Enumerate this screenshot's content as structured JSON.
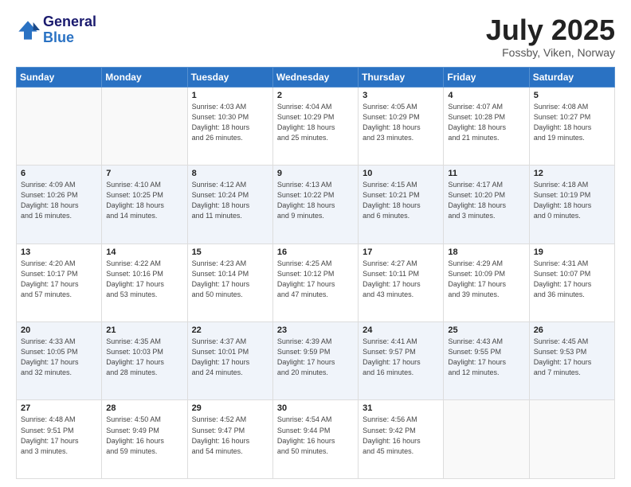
{
  "header": {
    "logo_line1": "General",
    "logo_line2": "Blue",
    "month": "July 2025",
    "location": "Fossby, Viken, Norway"
  },
  "days_of_week": [
    "Sunday",
    "Monday",
    "Tuesday",
    "Wednesday",
    "Thursday",
    "Friday",
    "Saturday"
  ],
  "weeks": [
    [
      {
        "day": "",
        "info": ""
      },
      {
        "day": "",
        "info": ""
      },
      {
        "day": "1",
        "info": "Sunrise: 4:03 AM\nSunset: 10:30 PM\nDaylight: 18 hours\nand 26 minutes."
      },
      {
        "day": "2",
        "info": "Sunrise: 4:04 AM\nSunset: 10:29 PM\nDaylight: 18 hours\nand 25 minutes."
      },
      {
        "day": "3",
        "info": "Sunrise: 4:05 AM\nSunset: 10:29 PM\nDaylight: 18 hours\nand 23 minutes."
      },
      {
        "day": "4",
        "info": "Sunrise: 4:07 AM\nSunset: 10:28 PM\nDaylight: 18 hours\nand 21 minutes."
      },
      {
        "day": "5",
        "info": "Sunrise: 4:08 AM\nSunset: 10:27 PM\nDaylight: 18 hours\nand 19 minutes."
      }
    ],
    [
      {
        "day": "6",
        "info": "Sunrise: 4:09 AM\nSunset: 10:26 PM\nDaylight: 18 hours\nand 16 minutes."
      },
      {
        "day": "7",
        "info": "Sunrise: 4:10 AM\nSunset: 10:25 PM\nDaylight: 18 hours\nand 14 minutes."
      },
      {
        "day": "8",
        "info": "Sunrise: 4:12 AM\nSunset: 10:24 PM\nDaylight: 18 hours\nand 11 minutes."
      },
      {
        "day": "9",
        "info": "Sunrise: 4:13 AM\nSunset: 10:22 PM\nDaylight: 18 hours\nand 9 minutes."
      },
      {
        "day": "10",
        "info": "Sunrise: 4:15 AM\nSunset: 10:21 PM\nDaylight: 18 hours\nand 6 minutes."
      },
      {
        "day": "11",
        "info": "Sunrise: 4:17 AM\nSunset: 10:20 PM\nDaylight: 18 hours\nand 3 minutes."
      },
      {
        "day": "12",
        "info": "Sunrise: 4:18 AM\nSunset: 10:19 PM\nDaylight: 18 hours\nand 0 minutes."
      }
    ],
    [
      {
        "day": "13",
        "info": "Sunrise: 4:20 AM\nSunset: 10:17 PM\nDaylight: 17 hours\nand 57 minutes."
      },
      {
        "day": "14",
        "info": "Sunrise: 4:22 AM\nSunset: 10:16 PM\nDaylight: 17 hours\nand 53 minutes."
      },
      {
        "day": "15",
        "info": "Sunrise: 4:23 AM\nSunset: 10:14 PM\nDaylight: 17 hours\nand 50 minutes."
      },
      {
        "day": "16",
        "info": "Sunrise: 4:25 AM\nSunset: 10:12 PM\nDaylight: 17 hours\nand 47 minutes."
      },
      {
        "day": "17",
        "info": "Sunrise: 4:27 AM\nSunset: 10:11 PM\nDaylight: 17 hours\nand 43 minutes."
      },
      {
        "day": "18",
        "info": "Sunrise: 4:29 AM\nSunset: 10:09 PM\nDaylight: 17 hours\nand 39 minutes."
      },
      {
        "day": "19",
        "info": "Sunrise: 4:31 AM\nSunset: 10:07 PM\nDaylight: 17 hours\nand 36 minutes."
      }
    ],
    [
      {
        "day": "20",
        "info": "Sunrise: 4:33 AM\nSunset: 10:05 PM\nDaylight: 17 hours\nand 32 minutes."
      },
      {
        "day": "21",
        "info": "Sunrise: 4:35 AM\nSunset: 10:03 PM\nDaylight: 17 hours\nand 28 minutes."
      },
      {
        "day": "22",
        "info": "Sunrise: 4:37 AM\nSunset: 10:01 PM\nDaylight: 17 hours\nand 24 minutes."
      },
      {
        "day": "23",
        "info": "Sunrise: 4:39 AM\nSunset: 9:59 PM\nDaylight: 17 hours\nand 20 minutes."
      },
      {
        "day": "24",
        "info": "Sunrise: 4:41 AM\nSunset: 9:57 PM\nDaylight: 17 hours\nand 16 minutes."
      },
      {
        "day": "25",
        "info": "Sunrise: 4:43 AM\nSunset: 9:55 PM\nDaylight: 17 hours\nand 12 minutes."
      },
      {
        "day": "26",
        "info": "Sunrise: 4:45 AM\nSunset: 9:53 PM\nDaylight: 17 hours\nand 7 minutes."
      }
    ],
    [
      {
        "day": "27",
        "info": "Sunrise: 4:48 AM\nSunset: 9:51 PM\nDaylight: 17 hours\nand 3 minutes."
      },
      {
        "day": "28",
        "info": "Sunrise: 4:50 AM\nSunset: 9:49 PM\nDaylight: 16 hours\nand 59 minutes."
      },
      {
        "day": "29",
        "info": "Sunrise: 4:52 AM\nSunset: 9:47 PM\nDaylight: 16 hours\nand 54 minutes."
      },
      {
        "day": "30",
        "info": "Sunrise: 4:54 AM\nSunset: 9:44 PM\nDaylight: 16 hours\nand 50 minutes."
      },
      {
        "day": "31",
        "info": "Sunrise: 4:56 AM\nSunset: 9:42 PM\nDaylight: 16 hours\nand 45 minutes."
      },
      {
        "day": "",
        "info": ""
      },
      {
        "day": "",
        "info": ""
      }
    ]
  ]
}
